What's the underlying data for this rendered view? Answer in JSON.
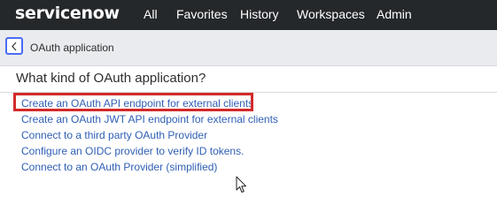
{
  "topnav": {
    "logo": "servicenow",
    "items": [
      {
        "label": "All"
      },
      {
        "label": "Favorites"
      },
      {
        "label": "History"
      },
      {
        "label": "Workspaces"
      },
      {
        "label": "Admin"
      }
    ]
  },
  "titlebar": {
    "title": "OAuth application"
  },
  "content": {
    "question": "What kind of OAuth application?",
    "options": [
      {
        "label": "Create an OAuth API endpoint for external clients",
        "highlighted": true
      },
      {
        "label": "Create an OAuth JWT API endpoint for external clients"
      },
      {
        "label": "Connect to a third party OAuth Provider"
      },
      {
        "label": "Configure an OIDC provider to verify ID tokens."
      },
      {
        "label": "Connect to an OAuth Provider (simplified)"
      }
    ]
  },
  "colors": {
    "nav_bg": "#25282b",
    "link": "#2f5fb5",
    "highlight": "#d32a2a"
  }
}
